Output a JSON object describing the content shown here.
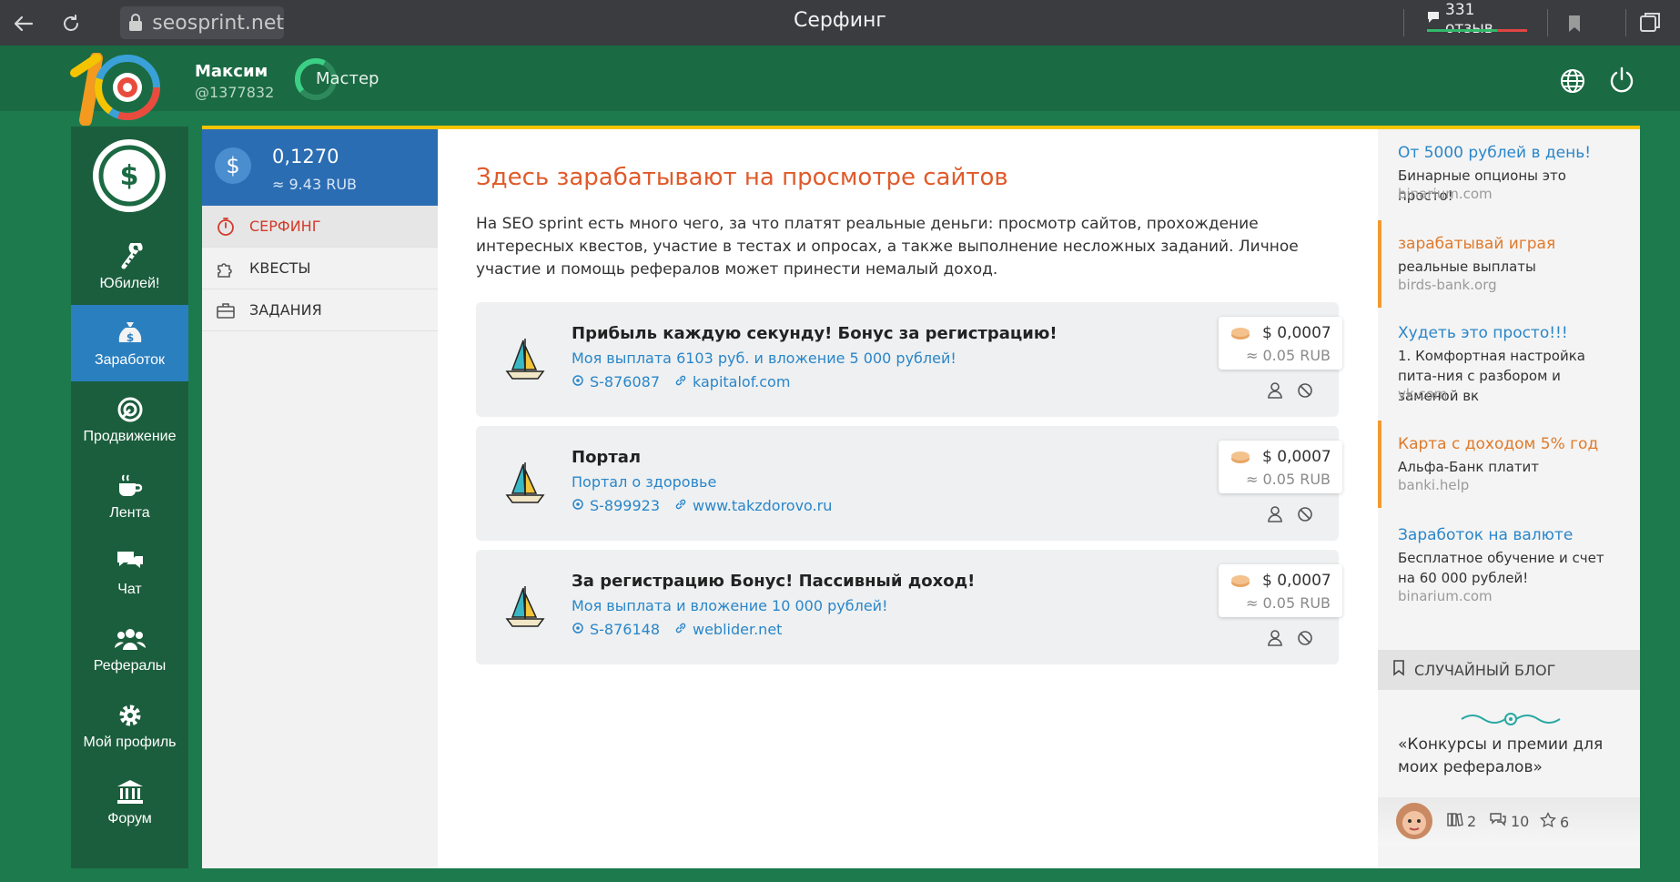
{
  "browser": {
    "url": "seosprint.net",
    "title": "Серфинг",
    "reviews": "331 отзыв"
  },
  "header": {
    "user_name": "Максим",
    "user_id": "@1377832",
    "rank": "Мастер"
  },
  "left_nav": [
    {
      "label": "Юбилей!",
      "icon": "candy-cane-icon"
    },
    {
      "label": "Заработок",
      "icon": "money-bag-icon",
      "active": true
    },
    {
      "label": "Продвижение",
      "icon": "target-icon"
    },
    {
      "label": "Лента",
      "icon": "coffee-cup-icon"
    },
    {
      "label": "Чат",
      "icon": "chat-bubbles-icon"
    },
    {
      "label": "Рефералы",
      "icon": "people-icon"
    },
    {
      "label": "Мой профиль",
      "icon": "gear-icon"
    },
    {
      "label": "Форум",
      "icon": "bank-building-icon"
    }
  ],
  "balance": {
    "usd": "0,1270",
    "rub": "≈ 9.43 RUB"
  },
  "sub_nav": [
    {
      "label": "СЕРФИНГ",
      "icon": "stopwatch-icon",
      "active": true
    },
    {
      "label": "КВЕСТЫ",
      "icon": "puzzle-icon"
    },
    {
      "label": "ЗАДАНИЯ",
      "icon": "briefcase-icon"
    }
  ],
  "main": {
    "headline": "Здесь зарабатывают на просмотре сайтов",
    "intro": "На SEO sprint есть много чего, за что платят реальные деньги: просмотр сайтов, прохождение интересных квестов, участие в тестах и опросах, а также выполнение несложных заданий. Личное участие и помощь рефералов может принести немалый доход."
  },
  "tasks": [
    {
      "title": "Прибыль каждую секунду! Бонус за регистрацию!",
      "desc": "Моя выплата 6103 руб. и вложение 5 000 рублей!",
      "id": "S-876087",
      "link": "kapitalof.com",
      "price_usd": "$ 0,0007",
      "price_rub": "≈ 0.05 RUB"
    },
    {
      "title": "Портал",
      "desc": "Портал о здоровье",
      "id": "S-899923",
      "link": "www.takzdorovo.ru",
      "price_usd": "$ 0,0007",
      "price_rub": "≈ 0.05 RUB"
    },
    {
      "title": "За регистрацию Бонус! Пассивный доход!",
      "desc": "Моя выплата и вложение 10 000 рублей!",
      "id": "S-876148",
      "link": "weblider.net",
      "price_usd": "$ 0,0007",
      "price_rub": "≈ 0.05 RUB"
    }
  ],
  "ads": [
    {
      "title": "От 5000 рублей в день!",
      "text": "Бинарные опционы это просто!",
      "domain": "binarium.com",
      "accent": "blue"
    },
    {
      "title": "зарабатывай играя",
      "text": "реальные выплаты",
      "domain": "birds-bank.org",
      "accent": "orange"
    },
    {
      "title": "Худеть это просто!!!",
      "text": "1. Комфортная настройка пита-ния с разбором и заменой вк",
      "domain": "vk.com",
      "accent": "blue"
    },
    {
      "title": "Карта с доходом 5% год",
      "text": "Альфа-Банк платит",
      "domain": "banki.help",
      "accent": "orange"
    },
    {
      "title": "Заработок на валюте",
      "text": "Бесплатное обучение и счет на 60 000 рублей!",
      "domain": "binarium.com",
      "accent": "blue"
    }
  ],
  "blog": {
    "heading": "СЛУЧАЙНЫЙ БЛОГ",
    "title": "«Конкурсы и премии для моих рефералов»",
    "posts": "2",
    "comments": "10",
    "stars": "6"
  },
  "colors": {
    "bg_green": "#1d7a4c",
    "header_green": "#1a6a43",
    "nav_green": "#1b5e3d",
    "active_blue": "#2a7fbf",
    "link_blue": "#2a86c9",
    "headline_orange": "#e05a2a",
    "accent_yellow": "#f5c400"
  }
}
